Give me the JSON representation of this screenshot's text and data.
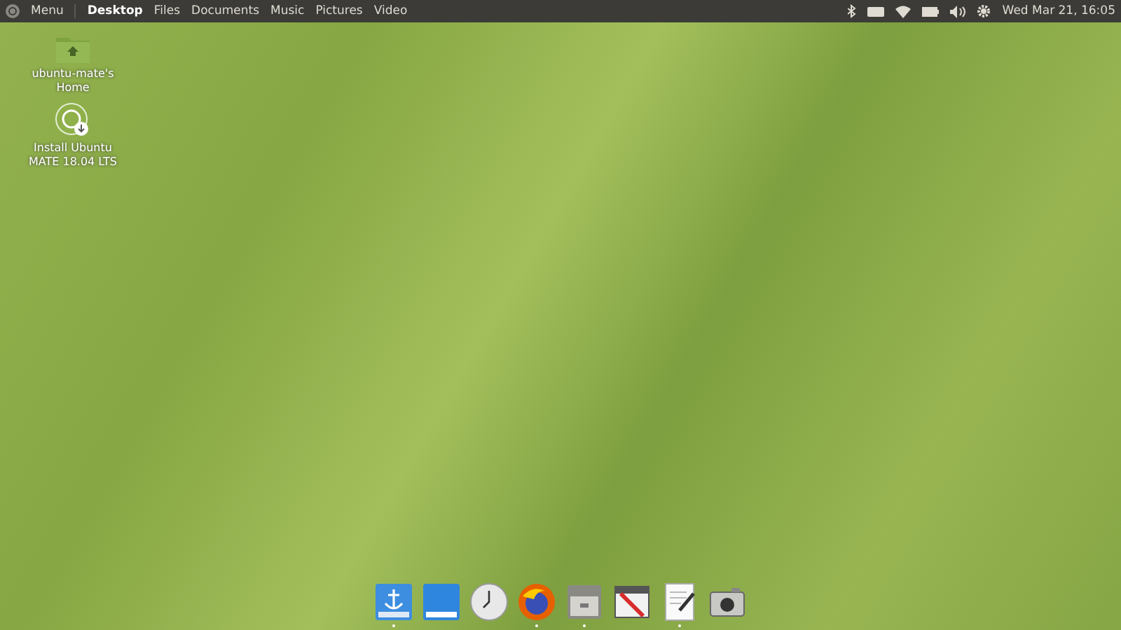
{
  "top_panel": {
    "menu_label": "Menu",
    "places": [
      {
        "label": "Desktop",
        "selected": true
      },
      {
        "label": "Files",
        "selected": false
      },
      {
        "label": "Documents",
        "selected": false
      },
      {
        "label": "Music",
        "selected": false
      },
      {
        "label": "Pictures",
        "selected": false
      },
      {
        "label": "Video",
        "selected": false
      }
    ],
    "clock": "Wed Mar 21, 16:05"
  },
  "desktop_icons": [
    {
      "kind": "folder",
      "label": "ubuntu-mate's Home"
    },
    {
      "kind": "installer",
      "label": "Install Ubuntu MATE 18.04 LTS"
    }
  ],
  "dock": [
    {
      "kind": "anchor",
      "running": true
    },
    {
      "kind": "window",
      "running": false
    },
    {
      "kind": "clock",
      "running": false
    },
    {
      "kind": "browser",
      "running": true
    },
    {
      "kind": "cabinet",
      "running": true
    },
    {
      "kind": "tools",
      "running": false
    },
    {
      "kind": "editor",
      "running": true
    },
    {
      "kind": "camera",
      "running": false
    }
  ]
}
